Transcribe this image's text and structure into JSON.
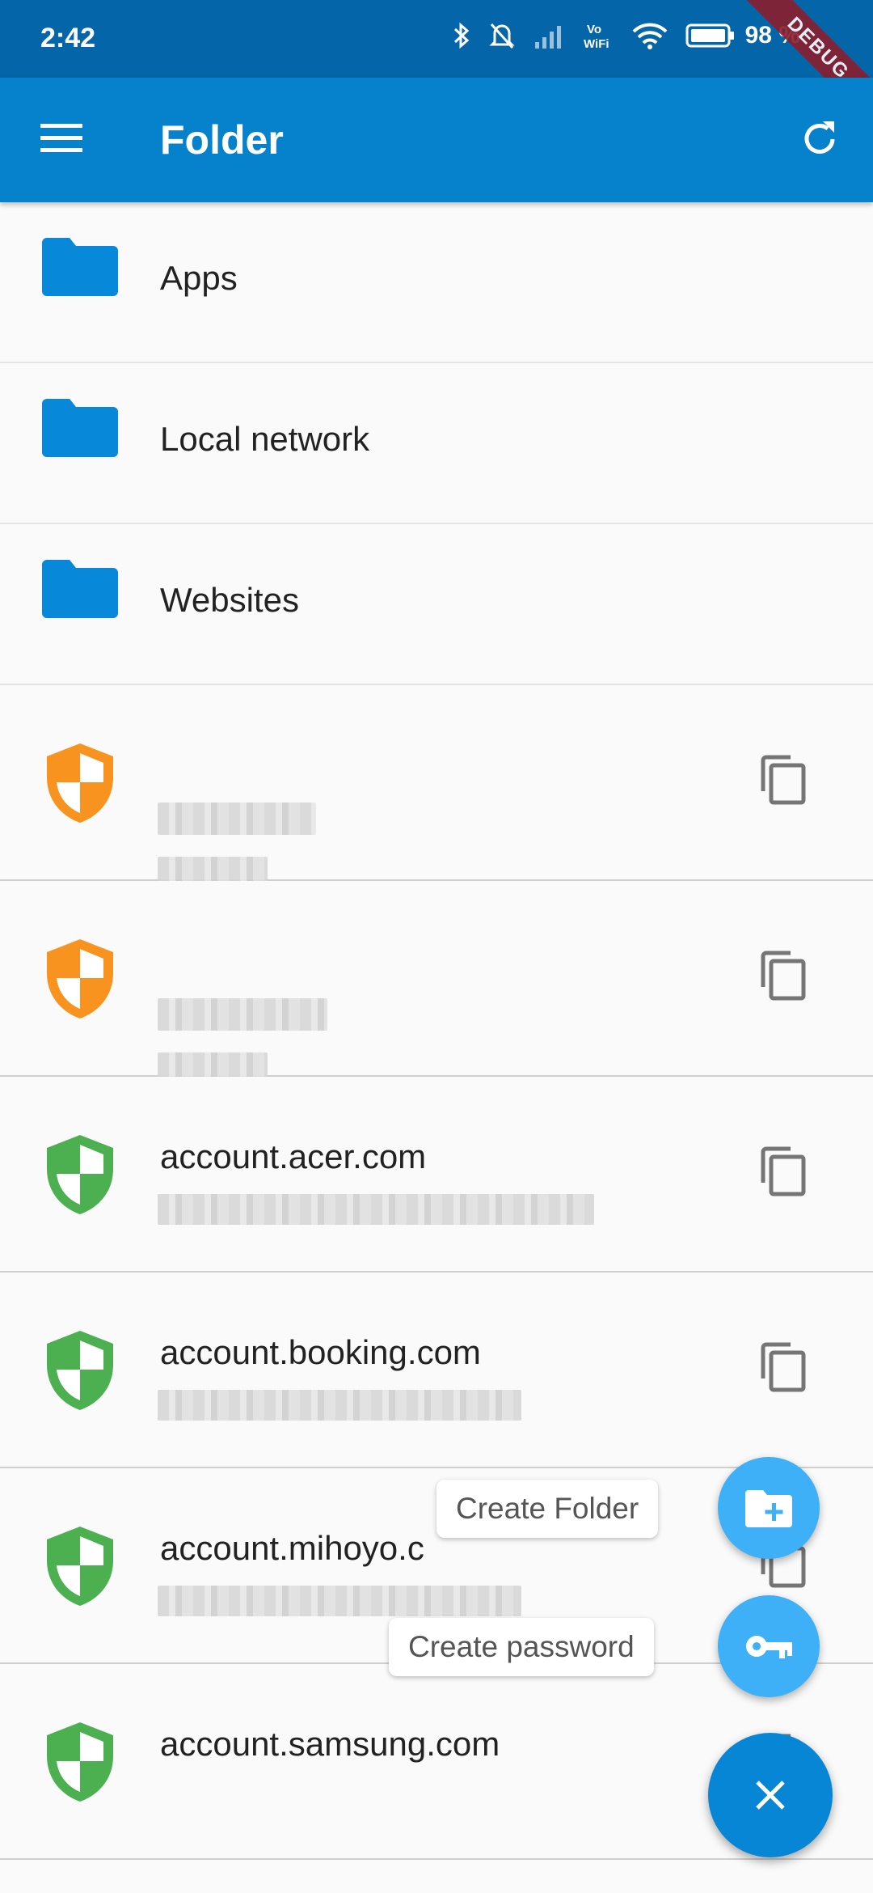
{
  "status_bar": {
    "time": "2:42",
    "battery": "98 %",
    "debug_banner": "DEBUG"
  },
  "app_bar": {
    "title": "Folder",
    "menu_icon": "menu-icon",
    "refresh_icon": "refresh-icon",
    "color": "#0681cc"
  },
  "folders": [
    {
      "label": "Apps"
    },
    {
      "label": "Local network"
    },
    {
      "label": "Websites"
    }
  ],
  "passwords": [
    {
      "name": "",
      "strength": "weak",
      "shield_color": "#f7931e"
    },
    {
      "name": "",
      "strength": "weak",
      "shield_color": "#f7931e"
    },
    {
      "name": "account.acer.com",
      "strength": "strong",
      "shield_color": "#4caf50"
    },
    {
      "name": "account.booking.com",
      "strength": "strong",
      "shield_color": "#4caf50"
    },
    {
      "name": "account.mihoyo.c",
      "strength": "strong",
      "shield_color": "#4caf50"
    },
    {
      "name": "account.samsung.com",
      "strength": "strong",
      "shield_color": "#4caf50"
    }
  ],
  "fab": {
    "create_folder_label": "Create Folder",
    "create_password_label": "Create password",
    "close_icon": "close-icon"
  }
}
